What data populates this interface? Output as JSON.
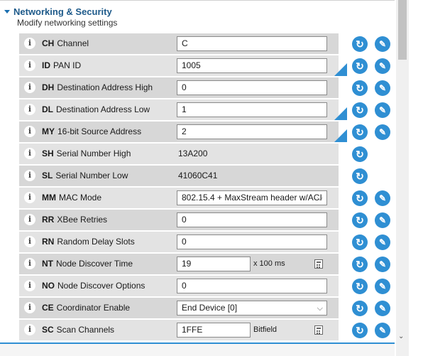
{
  "section": {
    "title": "Networking & Security",
    "subtitle": "Modify networking settings"
  },
  "icons": {
    "info": "i",
    "read": "↻",
    "write": "✎",
    "collapse": "triangle-down",
    "scroll_down": "⌄",
    "select_caret": "⌵"
  },
  "colors": {
    "accent": "#2f8fd3",
    "row": "#d7d7d7",
    "row_alt": "#e3e3e3"
  },
  "settings": [
    {
      "code": "CH",
      "name": "Channel",
      "type": "text",
      "value": "C"
    },
    {
      "code": "ID",
      "name": "PAN ID",
      "type": "text",
      "value": "1005",
      "modified": true
    },
    {
      "code": "DH",
      "name": "Destination Address High",
      "type": "text",
      "value": "0"
    },
    {
      "code": "DL",
      "name": "Destination Address Low",
      "type": "text",
      "value": "1",
      "modified": true
    },
    {
      "code": "MY",
      "name": "16-bit Source Address",
      "type": "text",
      "value": "2",
      "modified": true
    },
    {
      "code": "SH",
      "name": "Serial Number High",
      "type": "static",
      "value": "13A200"
    },
    {
      "code": "SL",
      "name": "Serial Number Low",
      "type": "static",
      "value": "41060C41"
    },
    {
      "code": "MM",
      "name": "MAC Mode",
      "type": "select",
      "value": "802.15.4 + MaxStream header w/ACI"
    },
    {
      "code": "RR",
      "name": "XBee Retries",
      "type": "text",
      "value": "0"
    },
    {
      "code": "RN",
      "name": "Random Delay Slots",
      "type": "text",
      "value": "0"
    },
    {
      "code": "NT",
      "name": "Node Discover Time",
      "type": "text-unit",
      "value": "19",
      "unit": "x 100 ms"
    },
    {
      "code": "NO",
      "name": "Node Discover Options",
      "type": "text",
      "value": "0"
    },
    {
      "code": "CE",
      "name": "Coordinator Enable",
      "type": "select",
      "value": "End Device [0]"
    },
    {
      "code": "SC",
      "name": "Scan Channels",
      "type": "text-unit",
      "value": "1FFE",
      "unit": "Bitfield"
    }
  ]
}
